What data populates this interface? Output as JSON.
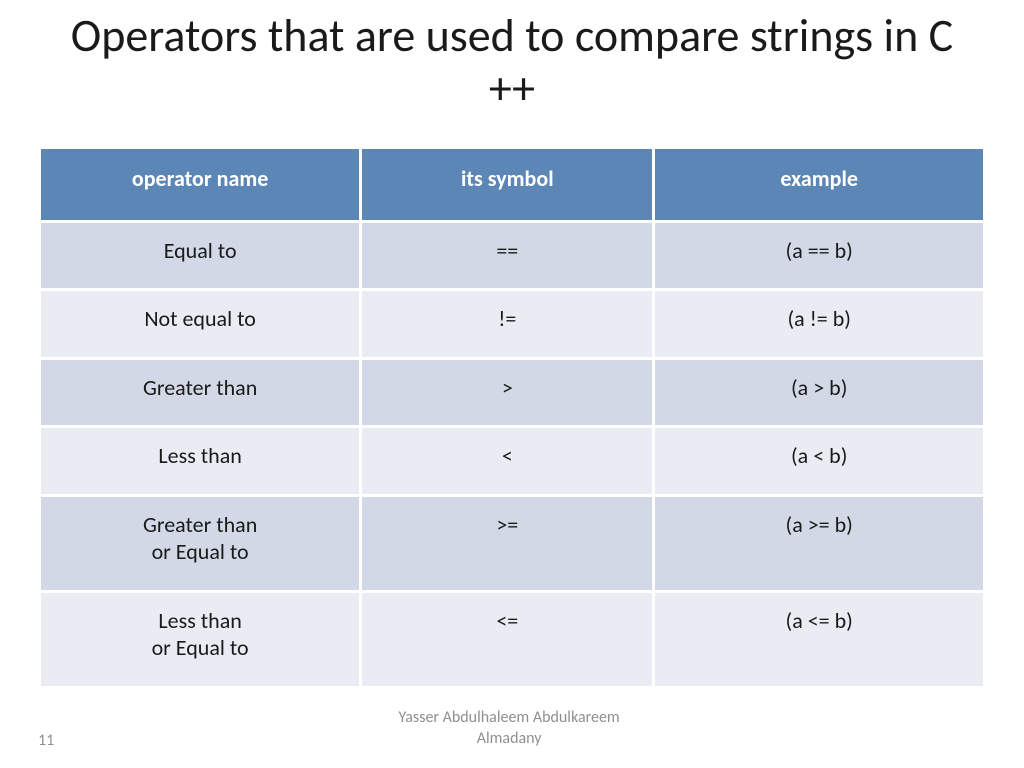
{
  "title": "Operators that are used to compare strings in C ++",
  "table": {
    "headers": [
      "operator name",
      "its symbol",
      "example"
    ],
    "rows": [
      {
        "name": "Equal to",
        "symbol": "==",
        "example": "(a == b)"
      },
      {
        "name": "Not equal to",
        "symbol": "!=",
        "example": "(a != b)"
      },
      {
        "name": "Greater than",
        "symbol": ">",
        "example": "(a > b)"
      },
      {
        "name": "Less than",
        "symbol": "<",
        "example": "(a < b)"
      },
      {
        "name": "Greater than\nor Equal to",
        "symbol": ">=",
        "example": "(a >= b)"
      },
      {
        "name": "Less than\nor Equal to",
        "symbol": "<=",
        "example": "(a <= b)"
      }
    ]
  },
  "footer": {
    "page_number": "11",
    "author": "Yasser Abdulhaleem Abdulkareem\nAlmadany"
  }
}
